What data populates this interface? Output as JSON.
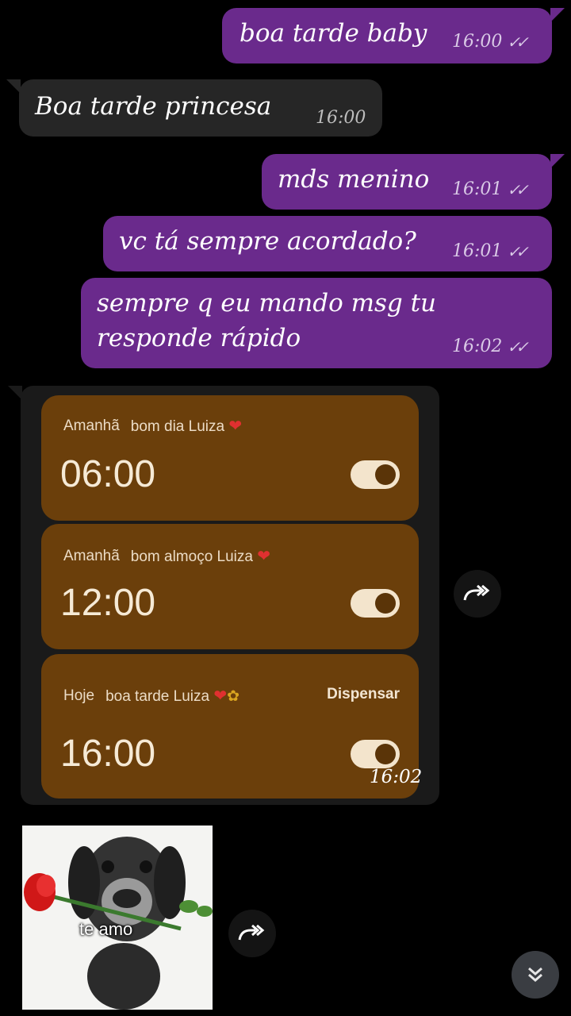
{
  "messages": [
    {
      "text": "boa tarde baby",
      "time": "16:00"
    },
    {
      "text": "Boa tarde princesa",
      "time": "16:00"
    },
    {
      "text": "mds menino",
      "time": "16:01"
    },
    {
      "text": "vc tá sempre acordado?",
      "time": "16:01"
    },
    {
      "text": "sempre q eu mando msg tu\nresponde rápido",
      "time": "16:02"
    }
  ],
  "alarm_screenshot": {
    "time": "16:02",
    "alarms": [
      {
        "day": "Amanhã",
        "label": "bom dia Luiza",
        "time": "06:00",
        "enabled": true
      },
      {
        "day": "Amanhã",
        "label": "bom almoço Luiza",
        "time": "12:00",
        "enabled": true
      },
      {
        "day": "Hoje",
        "label": "boa tarde Luiza",
        "time": "16:00",
        "enabled": true,
        "action": "Dispensar"
      }
    ]
  },
  "sticker": {
    "text": "te amo"
  },
  "icons": {
    "forward": "forward-icon",
    "scroll_down": "chevron-double-down-icon",
    "read": "double-check-icon"
  },
  "colors": {
    "outgoing_bubble": "#6a2a8c",
    "incoming_bubble": "#262626",
    "alarm_card": "#6b3f0b"
  }
}
